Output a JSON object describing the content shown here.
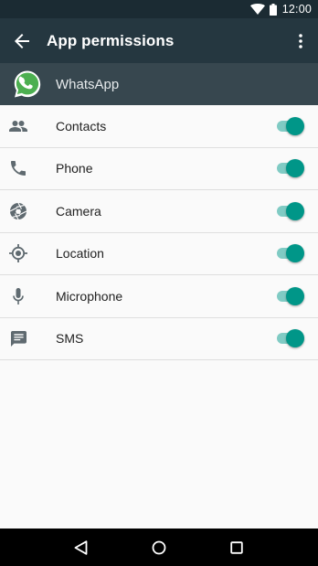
{
  "status_bar": {
    "time": "12:00",
    "icons": [
      "wifi-icon",
      "battery-icon"
    ]
  },
  "app_bar": {
    "title": "App permissions",
    "back_icon": "arrow-back-icon",
    "menu_icon": "more-vert-icon"
  },
  "app": {
    "name": "WhatsApp",
    "icon": "whatsapp-logo"
  },
  "permissions": [
    {
      "label": "Contacts",
      "icon": "people-icon",
      "enabled": true
    },
    {
      "label": "Phone",
      "icon": "phone-icon",
      "enabled": true
    },
    {
      "label": "Camera",
      "icon": "camera-icon",
      "enabled": true
    },
    {
      "label": "Location",
      "icon": "location-icon",
      "enabled": true
    },
    {
      "label": "Microphone",
      "icon": "microphone-icon",
      "enabled": true
    },
    {
      "label": "SMS",
      "icon": "sms-icon",
      "enabled": true
    }
  ],
  "nav_bar": {
    "buttons": [
      "back-triangle-icon",
      "home-circle-icon",
      "recents-square-icon"
    ]
  },
  "colors": {
    "status_bar": "#1b2b33",
    "app_bar": "#253740",
    "app_header": "#37474f",
    "toggle_on_thumb": "#009688",
    "toggle_on_track": "#80cbc4",
    "whatsapp_green": "#4caf50"
  }
}
